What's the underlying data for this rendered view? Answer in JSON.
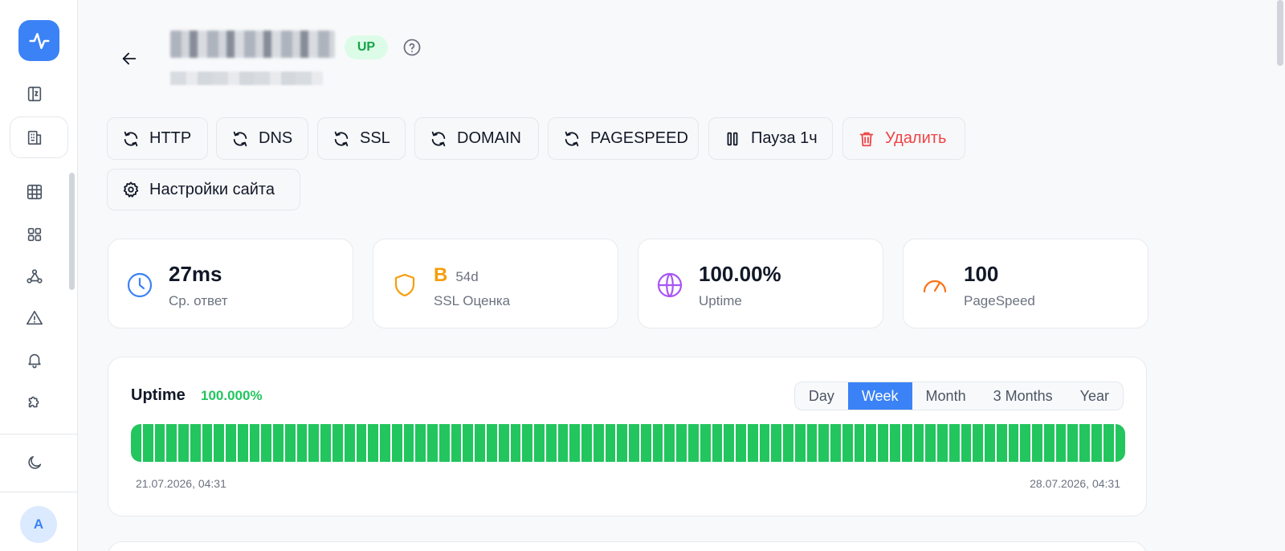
{
  "header": {
    "status_badge": "UP"
  },
  "actions": [
    {
      "label": "HTTP",
      "icon": "refresh-icon"
    },
    {
      "label": "DNS",
      "icon": "refresh-icon"
    },
    {
      "label": "SSL",
      "icon": "refresh-icon"
    },
    {
      "label": "DOMAIN",
      "icon": "refresh-icon"
    },
    {
      "label": "PAGESPEED",
      "icon": "refresh-icon"
    },
    {
      "label": "Пауза 1ч",
      "icon": "pause-icon"
    },
    {
      "label": "Удалить",
      "icon": "trash-icon"
    }
  ],
  "settings_button": {
    "label": "Настройки сайта",
    "icon": "gear-icon"
  },
  "stats": {
    "response": {
      "value": "27ms",
      "label": "Ср. ответ",
      "icon": "clock-icon",
      "color": "#3b82f6"
    },
    "ssl": {
      "grade": "B",
      "days": "54d",
      "label": "SSL Оценка",
      "icon": "shield-icon",
      "color": "#f59e0b"
    },
    "uptime": {
      "value": "100.00%",
      "label": "Uptime",
      "icon": "globe-icon",
      "color": "#a855f7"
    },
    "pagespeed": {
      "value": "100",
      "label": "PageSpeed",
      "icon": "gauge-icon",
      "color": "#f97316"
    }
  },
  "uptime_panel": {
    "title": "Uptime",
    "percent": "100.000%",
    "periods": [
      "Day",
      "Week",
      "Month",
      "3 Months",
      "Year"
    ],
    "selected_period": "Week",
    "start_time": "21.07.2026, 04:31",
    "end_time": "28.07.2026, 04:31",
    "segments_up": 84,
    "segment_color": "#22c55e"
  },
  "user": {
    "avatar_initial": "A"
  },
  "colors": {
    "accent": "#3b82f6",
    "up": "#22c55e",
    "danger": "#ef4444"
  }
}
